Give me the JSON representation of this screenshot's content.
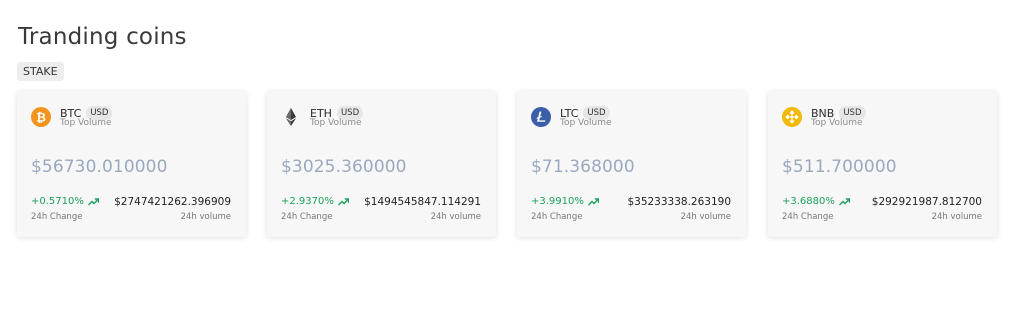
{
  "page": {
    "title": "Tranding coins"
  },
  "tag": {
    "label": "STAKE"
  },
  "cards": [
    {
      "symbol": "BTC",
      "currency": "USD",
      "subtitle": "Top Volume",
      "price": "$56730.010000",
      "change": "+0.5710%",
      "change_label": "24h Change",
      "volume": "$2747421262.396909",
      "volume_label": "24h volume",
      "icon": "bitcoin-icon",
      "icon_color": "#f2931e"
    },
    {
      "symbol": "ETH",
      "currency": "USD",
      "subtitle": "Top Volume",
      "price": "$3025.360000",
      "change": "+2.9370%",
      "change_label": "24h Change",
      "volume": "$1494545847.114291",
      "volume_label": "24h volume",
      "icon": "ethereum-icon",
      "icon_color": "#3c3c3d"
    },
    {
      "symbol": "LTC",
      "currency": "USD",
      "subtitle": "Top Volume",
      "price": "$71.368000",
      "change": "+3.9910%",
      "change_label": "24h Change",
      "volume": "$35233338.263190",
      "volume_label": "24h volume",
      "icon": "litecoin-icon",
      "icon_color": "#3a5fa8"
    },
    {
      "symbol": "BNB",
      "currency": "USD",
      "subtitle": "Top Volume",
      "price": "$511.700000",
      "change": "+3.6880%",
      "change_label": "24h Change",
      "volume": "$292921987.812700",
      "volume_label": "24h volume",
      "icon": "binance-icon",
      "icon_color": "#f0b90b"
    }
  ],
  "colors": {
    "positive": "#1c9e5a",
    "price": "#9aa9c0"
  }
}
